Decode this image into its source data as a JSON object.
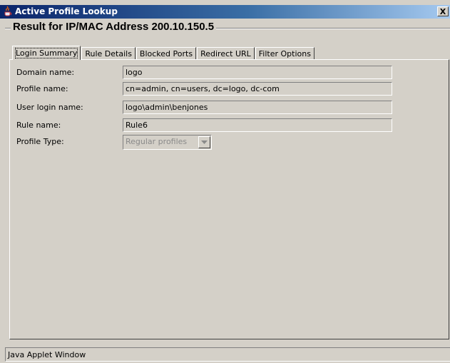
{
  "window": {
    "title": "Active Profile Lookup",
    "close_glyph": "X",
    "icon": "java-cup-icon"
  },
  "header": {
    "title": "Result for IP/MAC Address 200.10.150.5"
  },
  "tabs": [
    {
      "label": "Login Summary",
      "active": true
    },
    {
      "label": "Rule Details",
      "active": false
    },
    {
      "label": "Blocked Ports",
      "active": false
    },
    {
      "label": "Redirect URL",
      "active": false
    },
    {
      "label": "Filter Options",
      "active": false
    }
  ],
  "fields": {
    "domain": {
      "label": "Domain name:",
      "value": "logo"
    },
    "profile": {
      "label": "Profile name:",
      "value": "cn=admin, cn=users, dc=logo, dc-com"
    },
    "user_login": {
      "label": "User login name:",
      "value": "logo\\admin\\benjones"
    },
    "rule": {
      "label": "Rule name:",
      "value": "Rule6"
    },
    "profile_type": {
      "label": "Profile Type:",
      "value": "Regular profiles",
      "enabled": false
    }
  },
  "status": {
    "text": "Java Applet Window"
  },
  "colors": {
    "face": "#d4d0c8",
    "title_start": "#0a246a",
    "title_end": "#a6caf0",
    "disabled_text": "#8a8a8a"
  }
}
